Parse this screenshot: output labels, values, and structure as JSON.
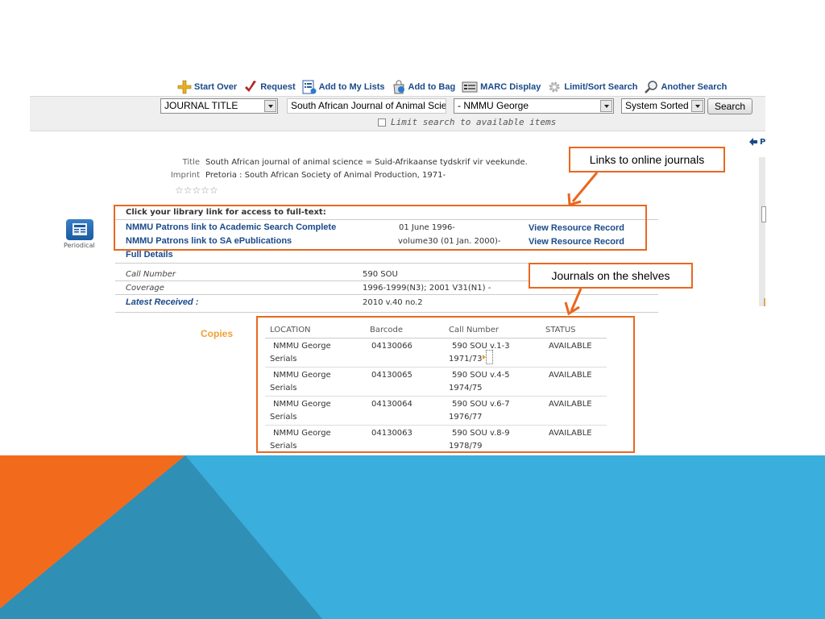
{
  "toolbar": {
    "start_over": "Start Over",
    "request": "Request",
    "add_to_lists": "Add to My Lists",
    "add_to_bag": "Add to Bag",
    "marc_display": "MARC Display",
    "limit_sort": "Limit/Sort Search",
    "another_search": "Another Search"
  },
  "search": {
    "field_select": "JOURNAL TITLE",
    "query": "South African Journal of Animal Scie",
    "location_select": "- NMMU George",
    "sort_select": "System Sorted",
    "button": "Search",
    "limit_label": "Limit search to available items"
  },
  "prev_link": "P",
  "record": {
    "title_label": "Title",
    "title_value": "South African journal of animal science = Suid-Afrikaanse tydskrif vir veekunde.",
    "imprint_label": "Imprint",
    "imprint_value": "Pretoria : South African Society of Animal Production, 1971-",
    "rating": "☆☆☆☆☆"
  },
  "periodical_label": "Periodical",
  "links": {
    "heading": "Click your library link for access to full-text:",
    "rows": [
      {
        "name": "NMMU Patrons link to Academic Search Complete",
        "coverage": "01 June 1996-",
        "action": "View Resource Record"
      },
      {
        "name": "NMMU Patrons link to SA ePublications",
        "coverage": "volume30 (01 Jan. 2000)-",
        "action": "View Resource Record"
      }
    ]
  },
  "full_details": "Full Details",
  "details": {
    "call_number_label": "Call Number",
    "call_number_value": "590 SOU",
    "coverage_label": "Coverage",
    "coverage_value": "1996-1999(N3); 2001 V31(N1) -",
    "latest_label": "Latest Received :",
    "latest_value": "2010 v.40 no.2"
  },
  "copies": {
    "label": "Copies",
    "headers": [
      "LOCATION",
      "Barcode",
      "Call Number",
      "STATUS"
    ],
    "rows": [
      {
        "location1": "NMMU George",
        "location2": "Serials",
        "barcode": "04130066",
        "call1": "590 SOU  v.1-3",
        "call2": "1971/73",
        "status": "AVAILABLE"
      },
      {
        "location1": "NMMU George",
        "location2": "Serials",
        "barcode": "04130065",
        "call1": "590 SOU  v.4-5",
        "call2": "1974/75",
        "status": "AVAILABLE"
      },
      {
        "location1": "NMMU George",
        "location2": "Serials",
        "barcode": "04130064",
        "call1": "590 SOU  v.6-7",
        "call2": "1976/77",
        "status": "AVAILABLE"
      },
      {
        "location1": "NMMU George",
        "location2": "Serials",
        "barcode": "04130063",
        "call1": "590 SOU  v.8-9",
        "call2": "1978/79",
        "status": "AVAILABLE"
      }
    ]
  },
  "callouts": {
    "online": "Links to online journals",
    "shelves": "Journals on the shelves"
  },
  "colors": {
    "callout_orange": "#e9681e",
    "link_blue": "#1a4a8a",
    "slide_blue": "#3aaedc",
    "slide_orange": "#f26b1d"
  }
}
